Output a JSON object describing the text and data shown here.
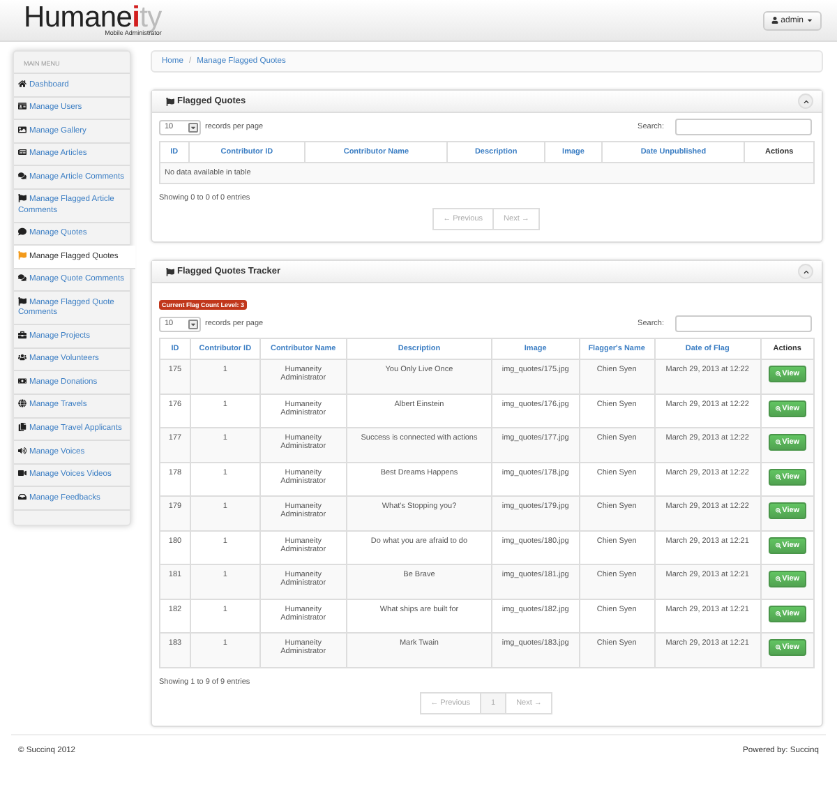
{
  "logo": {
    "main": "Humane",
    "accent": "i",
    "faded": "ty",
    "subtitle": "Mobile Administrator"
  },
  "user_menu": {
    "label": "admin"
  },
  "sidebar": {
    "heading": "MAIN MENU",
    "items": [
      {
        "label": "Dashboard",
        "selected": false
      },
      {
        "label": "Manage Users",
        "selected": false
      },
      {
        "label": "Manage Gallery",
        "selected": false
      },
      {
        "label": "Manage Articles",
        "selected": false
      },
      {
        "label": "Manage Article Comments",
        "selected": false
      },
      {
        "label": "Manage Flagged Article Comments",
        "selected": false
      },
      {
        "label": "Manage Quotes",
        "selected": false
      },
      {
        "label": "Manage Flagged Quotes",
        "selected": true
      },
      {
        "label": "Manage Quote Comments",
        "selected": false
      },
      {
        "label": "Manage Flagged Quote Comments",
        "selected": false
      },
      {
        "label": "Manage Projects",
        "selected": false
      },
      {
        "label": "Manage Volunteers",
        "selected": false
      },
      {
        "label": "Manage Donations",
        "selected": false
      },
      {
        "label": "Manage Travels",
        "selected": false
      },
      {
        "label": "Manage Travel Applicants",
        "selected": false
      },
      {
        "label": "Manage Voices",
        "selected": false
      },
      {
        "label": "Manage Voices Videos",
        "selected": false
      },
      {
        "label": "Manage Feedbacks",
        "selected": false
      }
    ]
  },
  "breadcrumb": {
    "separator": "/",
    "items": [
      "Home",
      "Manage Flagged Quotes"
    ]
  },
  "panels": [
    {
      "title": "Flagged Quotes",
      "page_size": "10",
      "page_size_label": "records per page",
      "search_label": "Search:",
      "columns": [
        {
          "label": "ID",
          "sortable": true
        },
        {
          "label": "Contributor ID",
          "sortable": true
        },
        {
          "label": "Contributor Name",
          "sortable": true
        },
        {
          "label": "Description",
          "sortable": true
        },
        {
          "label": "Image",
          "sortable": true
        },
        {
          "label": "Date Unpublished",
          "sortable": true
        },
        {
          "label": "Actions",
          "sortable": false
        }
      ],
      "empty_message": "No data available in table",
      "info": "Showing 0 to 0 of 0 entries",
      "pagination": {
        "previous": "← Previous",
        "next": "Next →"
      }
    },
    {
      "title": "Flagged Quotes Tracker",
      "badge": "Current Flag Count Level: 3",
      "page_size": "10",
      "page_size_label": "records per page",
      "search_label": "Search:",
      "columns": [
        {
          "label": "ID",
          "sortable": true
        },
        {
          "label": "Contributor ID",
          "sortable": true
        },
        {
          "label": "Contributor Name",
          "sortable": true
        },
        {
          "label": "Description",
          "sortable": true
        },
        {
          "label": "Image",
          "sortable": true
        },
        {
          "label": "Flagger's Name",
          "sortable": true
        },
        {
          "label": "Date of Flag",
          "sortable": true
        },
        {
          "label": "Actions",
          "sortable": false
        }
      ],
      "rows": [
        {
          "cells": [
            "175",
            "1",
            "Humaneity Administrator",
            "You Only Live Once",
            "img_quotes/175.jpg",
            "Chien Syen",
            "March 29, 2013 at 12:22"
          ],
          "action": "View"
        },
        {
          "cells": [
            "176",
            "1",
            "Humaneity Administrator",
            "Albert Einstein",
            "img_quotes/176.jpg",
            "Chien Syen",
            "March 29, 2013 at 12:22"
          ],
          "action": "View"
        },
        {
          "cells": [
            "177",
            "1",
            "Humaneity Administrator",
            "Success is connected with actions",
            "img_quotes/177.jpg",
            "Chien Syen",
            "March 29, 2013 at 12:22"
          ],
          "action": "View"
        },
        {
          "cells": [
            "178",
            "1",
            "Humaneity Administrator",
            "Best Dreams Happens",
            "img_quotes/178.jpg",
            "Chien Syen",
            "March 29, 2013 at 12:22"
          ],
          "action": "View"
        },
        {
          "cells": [
            "179",
            "1",
            "Humaneity Administrator",
            "What's Stopping you?",
            "img_quotes/179.jpg",
            "Chien Syen",
            "March 29, 2013 at 12:22"
          ],
          "action": "View"
        },
        {
          "cells": [
            "180",
            "1",
            "Humaneity Administrator",
            "Do what you are afraid to do",
            "img_quotes/180.jpg",
            "Chien Syen",
            "March 29, 2013 at 12:21"
          ],
          "action": "View"
        },
        {
          "cells": [
            "181",
            "1",
            "Humaneity Administrator",
            "Be Brave",
            "img_quotes/181.jpg",
            "Chien Syen",
            "March 29, 2013 at 12:21"
          ],
          "action": "View"
        },
        {
          "cells": [
            "182",
            "1",
            "Humaneity Administrator",
            "What ships are built for",
            "img_quotes/182.jpg",
            "Chien Syen",
            "March 29, 2013 at 12:21"
          ],
          "action": "View"
        },
        {
          "cells": [
            "183",
            "1",
            "Humaneity Administrator",
            "Mark Twain",
            "img_quotes/183.jpg",
            "Chien Syen",
            "March 29, 2013 at 12:21"
          ],
          "action": "View"
        }
      ],
      "info": "Showing 1 to 9 of 9 entries",
      "pagination": {
        "previous": "← Previous",
        "page": "1",
        "next": "Next →"
      }
    }
  ],
  "footer": {
    "copyright": "© Succinq 2012",
    "powered": "Powered by: Succinq"
  }
}
